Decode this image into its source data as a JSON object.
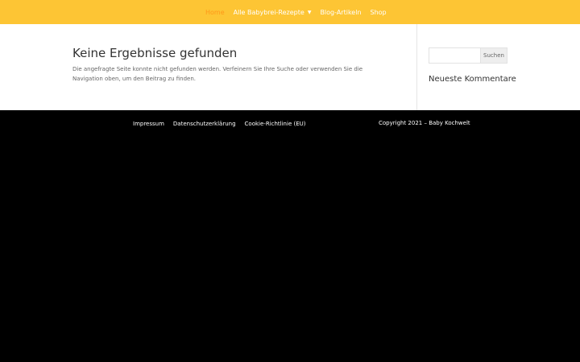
{
  "header": {
    "nav": [
      {
        "label": "Home",
        "active": true
      },
      {
        "label": "Alle Babybrei-Rezepte",
        "has_dropdown": true
      },
      {
        "label": "Blog-Artikeln"
      },
      {
        "label": "Shop"
      }
    ]
  },
  "main": {
    "title": "Keine Ergebnisse gefunden",
    "body": "Die angefragte Seite konnte nicht gefunden werden. Verfeinern Sie Ihre Suche oder verwenden Sie die Navigation oben, um den Beitrag zu finden."
  },
  "sidebar": {
    "search": {
      "value": "",
      "button_label": "Suchen"
    },
    "widget_title": "Neueste Kommentare"
  },
  "footer": {
    "links": [
      "Impressum",
      "Datenschutzerklärung",
      "Cookie-Richtlinie (EU)"
    ],
    "copyright": "Copyright 2021 – Baby Kochwelt"
  },
  "colors": {
    "header_bg": "#fdc534",
    "nav_active": "#ff9819",
    "nav_text": "#ffffff",
    "footer_bg": "#000000"
  }
}
